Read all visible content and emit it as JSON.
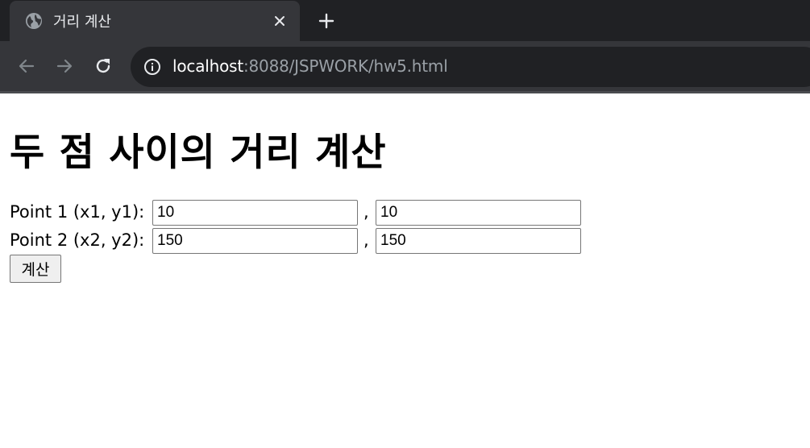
{
  "browser": {
    "tab": {
      "title": "거리 계산",
      "favicon": "globe-icon",
      "close_icon": "close-icon"
    },
    "new_tab_icon": "plus-icon",
    "nav": {
      "back_icon": "arrow-left-icon",
      "forward_icon": "arrow-right-icon",
      "reload_icon": "reload-icon"
    },
    "address_bar": {
      "info_icon": "info-icon",
      "host": "localhost",
      "rest": ":8088/JSPWORK/hw5.html"
    },
    "colors": {
      "tabstrip_bg": "#202124",
      "toolbar_bg": "#35363a",
      "omnibox_bg": "#202124"
    }
  },
  "page": {
    "title": "두 점 사이의 거리 계산",
    "point1": {
      "label": "Point 1 (x1, y1):",
      "x_value": "10",
      "separator": ",",
      "y_value": "10"
    },
    "point2": {
      "label": "Point 2 (x2, y2):",
      "x_value": "150",
      "separator": ",",
      "y_value": "150"
    },
    "calculate_button": "계산"
  }
}
